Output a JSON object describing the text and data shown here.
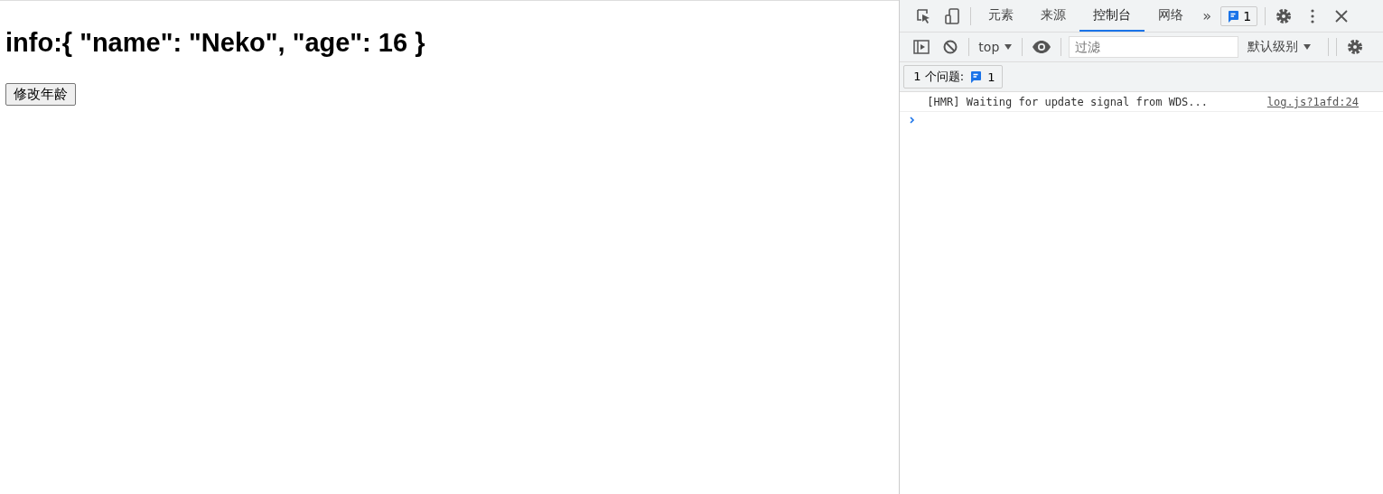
{
  "page": {
    "heading": "info:{ \"name\": \"Neko\", \"age\": 16 }",
    "button": "修改年龄"
  },
  "devtools": {
    "tabs": [
      {
        "label": "元素",
        "selected": false
      },
      {
        "label": "来源",
        "selected": false
      },
      {
        "label": "控制台",
        "selected": true
      },
      {
        "label": "网络",
        "selected": false
      }
    ],
    "more": "»",
    "issues_badge": "1",
    "context": "top",
    "filter": {
      "placeholder": "过滤"
    },
    "level": "默认级别",
    "issues_bar": {
      "label": "1 个问题:",
      "count": "1"
    },
    "messages": [
      {
        "text": "[HMR] Waiting for update signal from WDS...",
        "source": "log.js?1afd:24"
      }
    ]
  }
}
